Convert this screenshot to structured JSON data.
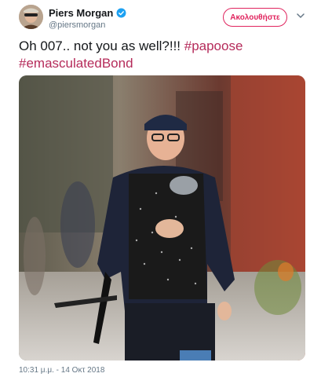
{
  "header": {
    "display_name": "Piers Morgan",
    "handle": "@piersmorgan",
    "follow_label": "Ακολουθήστε"
  },
  "tweet": {
    "text_plain": "Oh 007.. not you as well?!!! ",
    "hashtags": [
      "#papoose",
      "#emasculatedBond"
    ]
  },
  "footer": {
    "timestamp": "10:31 μ.μ. - 14 Οκτ 2018"
  },
  "colors": {
    "hashtag": "#b52b5a",
    "follow_accent": "#e0245e",
    "verified": "#1da1f2",
    "muted": "#657786"
  },
  "icons": {
    "verified": "verified-badge-icon",
    "menu": "chevron-down-icon"
  }
}
